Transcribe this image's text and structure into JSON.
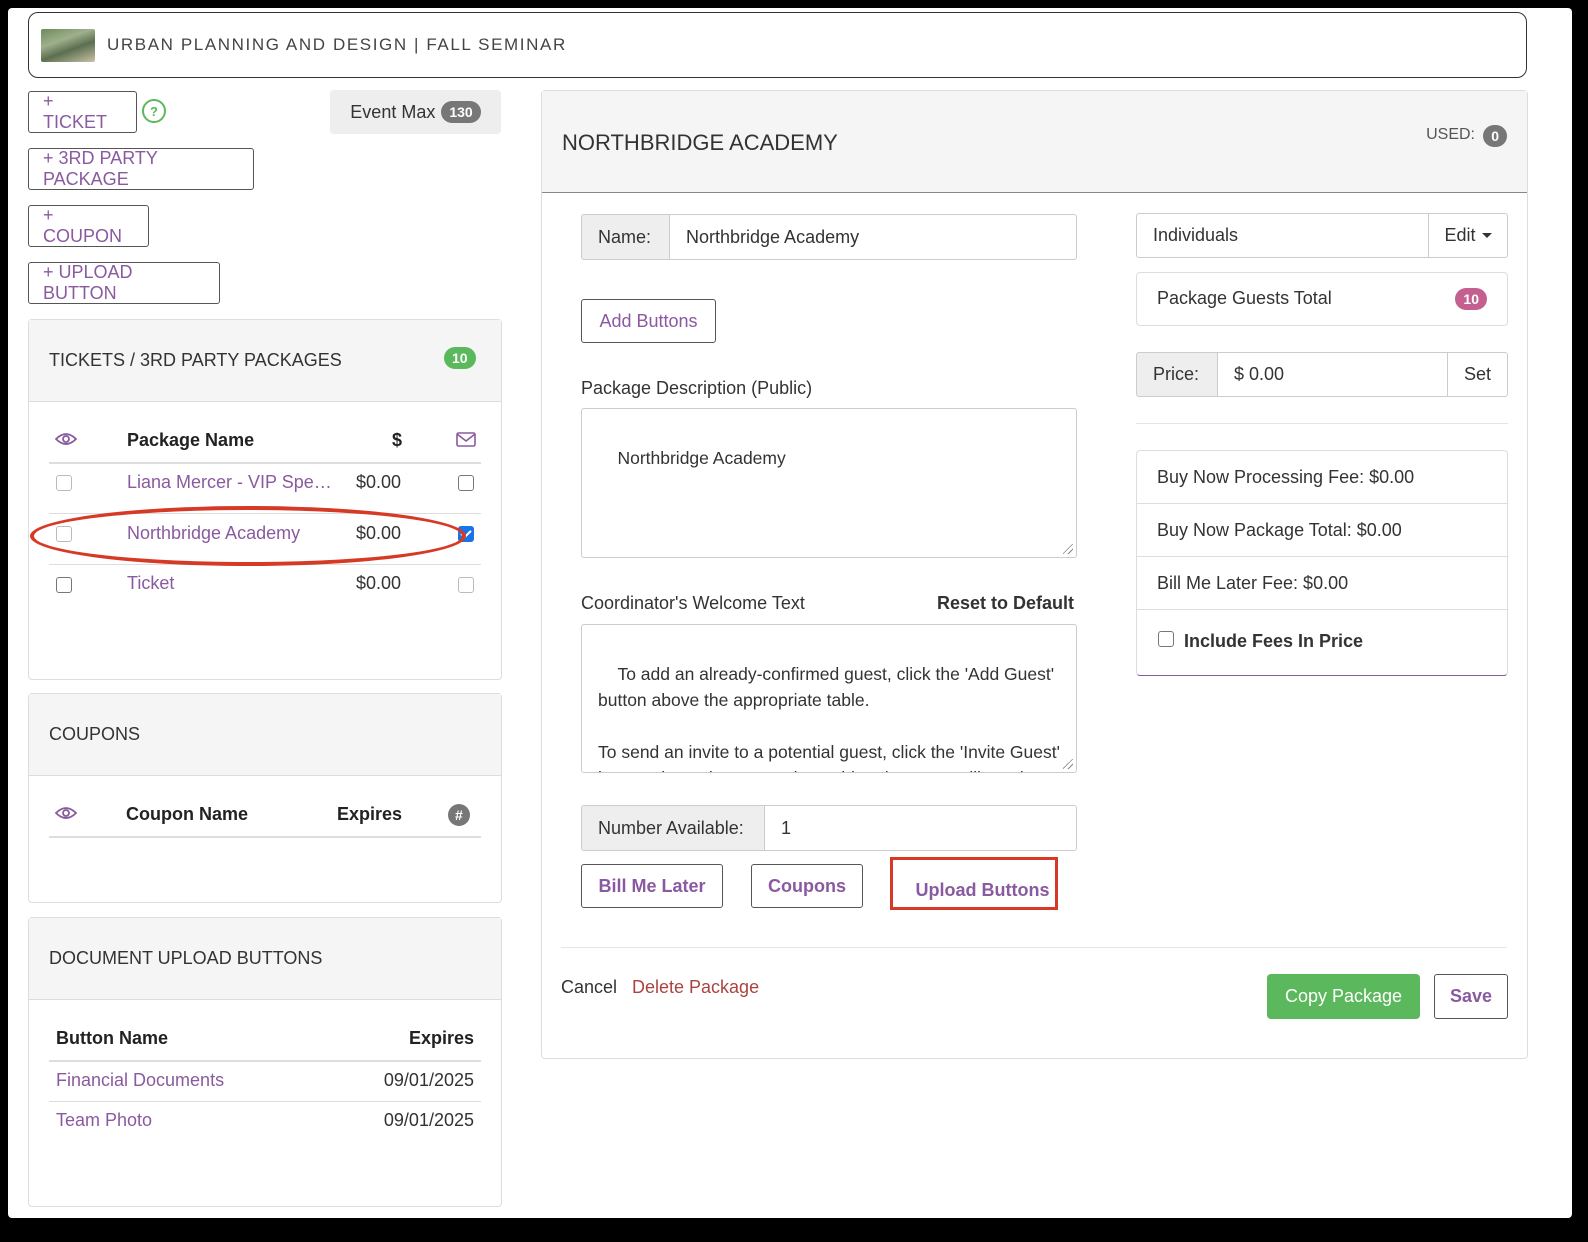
{
  "header": {
    "title": "URBAN PLANNING AND DESIGN | FALL SEMINAR"
  },
  "left": {
    "add_ticket": "+ TICKET",
    "help": "?",
    "add_3rd_party": "+ 3RD PARTY PACKAGE",
    "add_coupon": "+ COUPON",
    "add_upload": "+ UPLOAD BUTTON",
    "event_max_label": "Event Max",
    "event_max_value": "130"
  },
  "tickets_panel": {
    "title": "TICKETS / 3RD PARTY PACKAGES",
    "count": "10",
    "col_name": "Package Name",
    "col_price": "$",
    "rows": [
      {
        "name": "Liana Mercer - VIP Spe…",
        "price": "$0.00"
      },
      {
        "name": "Northbridge Academy",
        "price": "$0.00"
      },
      {
        "name": "Ticket",
        "price": "$0.00"
      }
    ]
  },
  "coupons_panel": {
    "title": "COUPONS",
    "col_name": "Coupon Name",
    "col_expires": "Expires",
    "col_hash": "#"
  },
  "uploads_panel": {
    "title": "DOCUMENT UPLOAD BUTTONS",
    "col_name": "Button Name",
    "col_expires": "Expires",
    "rows": [
      {
        "name": "Financial Documents",
        "expires": "09/01/2025"
      },
      {
        "name": "Team Photo",
        "expires": "09/01/2025"
      }
    ]
  },
  "editor": {
    "title": "NORTHBRIDGE ACADEMY",
    "used_label": "USED:",
    "used_value": "0",
    "name_label": "Name:",
    "name_value": "Northbridge Academy",
    "add_buttons": "Add Buttons",
    "desc_label": "Package Description (Public)",
    "desc_value": "Northbridge Academy",
    "welcome_label": "Coordinator's Welcome Text",
    "reset_default": "Reset to Default",
    "welcome_value": "To add an already-confirmed guest, click the 'Add Guest' button above the appropriate table.\n\nTo send an invite to a potential guest, click the 'Invite Guest' button above the appropriate table. The guest will receive an invite email for you potential guest to",
    "number_label": "Number Available:",
    "number_value": "1",
    "bill_me_later": "Bill Me Later",
    "coupons": "Coupons",
    "upload_buttons": "Upload Buttons",
    "cancel": "Cancel",
    "delete": "Delete Package",
    "copy": "Copy Package",
    "save": "Save"
  },
  "right": {
    "type_value": "Individuals",
    "edit_label": "Edit",
    "guests_total_label": "Package Guests Total",
    "guests_total_value": "10",
    "price_label": "Price:",
    "price_value": "$ 0.00",
    "set_label": "Set",
    "fees": [
      "Buy Now Processing Fee: $0.00",
      "Buy Now Package Total: $0.00",
      "Bill Me Later Fee: $0.00"
    ],
    "include_fees": "Include Fees In Price"
  },
  "colors": {
    "accent": "#8a5aa0",
    "success": "#5cb85c",
    "danger_link": "#a94442",
    "annotation": "#d63a26"
  }
}
